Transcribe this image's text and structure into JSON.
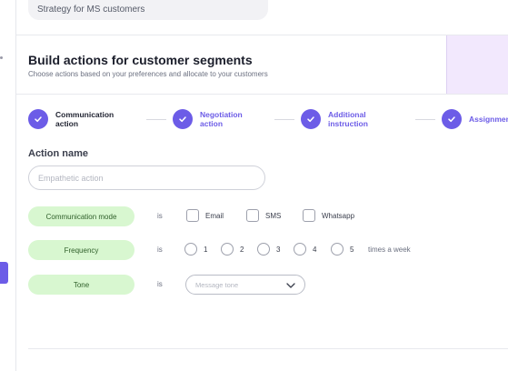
{
  "strategy": {
    "label": "Strategy for MS customers"
  },
  "header": {
    "title": "Build actions for customer segments",
    "subtitle": "Choose actions based on your preferences and allocate to your customers"
  },
  "stepper": {
    "steps": [
      {
        "label": "Communication action",
        "state": "done"
      },
      {
        "label": "Negotiation action",
        "state": "done"
      },
      {
        "label": "Additional instruction",
        "state": "done"
      },
      {
        "label": "Assignment",
        "state": "done"
      }
    ]
  },
  "action": {
    "label": "Action name",
    "placeholder": "Empathetic action",
    "value": ""
  },
  "rows": {
    "communication": {
      "param": "Communication mode",
      "is": "is",
      "options": [
        "Email",
        "SMS",
        "Whatsapp"
      ]
    },
    "frequency": {
      "param": "Frequency",
      "is": "is",
      "options": [
        "1",
        "2",
        "3",
        "4",
        "5"
      ],
      "suffix": "times a week"
    },
    "tone": {
      "param": "Tone",
      "is": "is",
      "placeholder": "Message tone"
    }
  },
  "colors": {
    "accent": "#6c5ce7",
    "param_pill_bg": "#d8f7d0",
    "hero_panel": "#f2e8fd"
  },
  "icons": {
    "step_done": "check-icon",
    "select": "chevron-down-icon"
  }
}
